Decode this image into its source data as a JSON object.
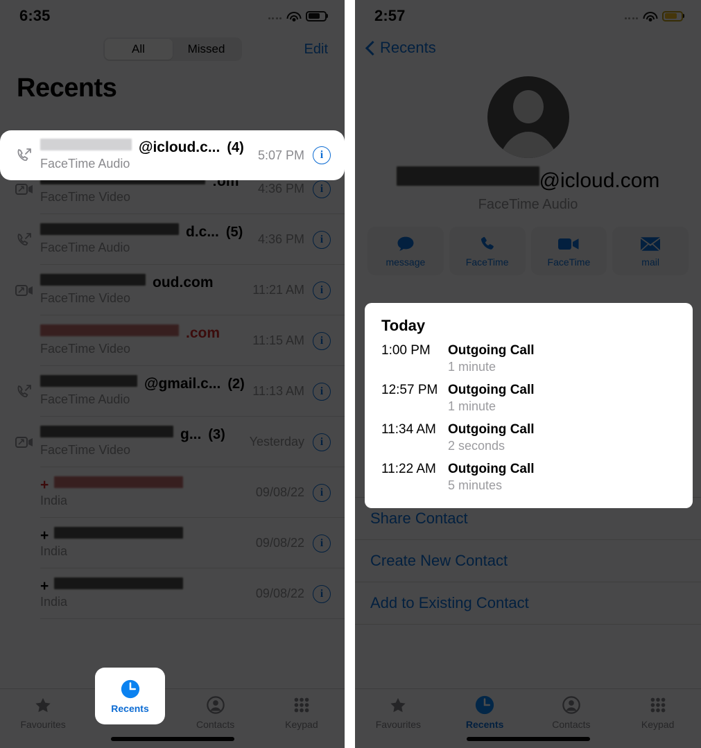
{
  "colors": {
    "accent_blue": "#0b6bd3",
    "missed_red": "#c62828",
    "muted_gray": "#8a8a8e",
    "dim_overlay": "#4d4d4d",
    "battery_low_power": "#e8b425"
  },
  "left_phone": {
    "status_bar": {
      "time": "6:35",
      "wifi": "wifi-icon",
      "battery": "battery-icon",
      "signal": "signal-dots-icon"
    },
    "segmented_control": {
      "options": [
        "All",
        "Missed"
      ],
      "selected": "All"
    },
    "edit_button": "Edit",
    "page_title": "Recents",
    "calls": [
      {
        "icon": "outgoing-audio-call-icon",
        "name_visible": "@icloud.c...",
        "redacted": true,
        "count": "(4)",
        "type": "FaceTime Audio",
        "time": "5:07 PM",
        "missed": false,
        "highlighted": true
      },
      {
        "icon": "outgoing-video-call-icon",
        "name_visible": ":om",
        "redacted": true,
        "count": "",
        "type": "FaceTime Video",
        "time": "4:36 PM",
        "missed": false,
        "highlighted": false
      },
      {
        "icon": "outgoing-audio-call-icon",
        "name_visible": "d.c...",
        "redacted": true,
        "count": "(5)",
        "type": "FaceTime Audio",
        "time": "4:36 PM",
        "missed": false,
        "highlighted": false
      },
      {
        "icon": "outgoing-video-call-icon",
        "name_visible": "oud.com",
        "redacted": true,
        "count": "",
        "type": "FaceTime Video",
        "time": "11:21 AM",
        "missed": false,
        "highlighted": false
      },
      {
        "icon": "",
        "name_visible": ".com",
        "redacted": true,
        "count": "",
        "type": "FaceTime Video",
        "time": "11:15 AM",
        "missed": true,
        "highlighted": false
      },
      {
        "icon": "outgoing-audio-call-icon",
        "name_visible": "@gmail.c...",
        "redacted": true,
        "count": "(2)",
        "type": "FaceTime Audio",
        "time": "11:13 AM",
        "missed": false,
        "highlighted": false
      },
      {
        "icon": "outgoing-video-call-icon",
        "name_visible": "g...",
        "redacted": true,
        "count": "(3)",
        "type": "FaceTime Video",
        "time": "Yesterday",
        "missed": false,
        "highlighted": false
      },
      {
        "icon": "",
        "name_visible": "+",
        "redacted": true,
        "count": "",
        "type": "India",
        "time": "09/08/22",
        "missed": true,
        "highlighted": false
      },
      {
        "icon": "",
        "name_visible": "+",
        "redacted": true,
        "count": "",
        "type": "India",
        "time": "09/08/22",
        "missed": false,
        "highlighted": false
      },
      {
        "icon": "",
        "name_visible": "+",
        "redacted": true,
        "count": "",
        "type": "India",
        "time": "09/08/22",
        "missed": false,
        "highlighted": false
      }
    ],
    "tabs": [
      {
        "label": "Favourites",
        "icon": "star-icon",
        "active": false
      },
      {
        "label": "Recents",
        "icon": "clock-icon",
        "active": true
      },
      {
        "label": "Contacts",
        "icon": "person-circle-icon",
        "active": false
      },
      {
        "label": "Keypad",
        "icon": "keypad-grid-icon",
        "active": false
      }
    ],
    "highlight_tab": "Recents"
  },
  "right_phone": {
    "status_bar": {
      "time": "2:57",
      "wifi": "wifi-icon",
      "battery": "battery-low-power-icon",
      "signal": "signal-dots-icon"
    },
    "back_button": "Recents",
    "avatar": "default-person-avatar-icon",
    "contact_id_visible": "@icloud.com",
    "contact_subtitle": "FaceTime Audio",
    "actions": [
      {
        "label": "message",
        "icon": "message-bubble-icon"
      },
      {
        "label": "FaceTime",
        "icon": "phone-handset-icon"
      },
      {
        "label": "FaceTime",
        "icon": "video-camera-icon"
      },
      {
        "label": "mail",
        "icon": "envelope-icon"
      }
    ],
    "history": {
      "section_title": "Today",
      "entries": [
        {
          "time": "1:00 PM",
          "kind": "Outgoing Call",
          "duration": "1 minute"
        },
        {
          "time": "12:57 PM",
          "kind": "Outgoing Call",
          "duration": "1 minute"
        },
        {
          "time": "11:34 AM",
          "kind": "Outgoing Call",
          "duration": "2 seconds"
        },
        {
          "time": "11:22 AM",
          "kind": "Outgoing Call",
          "duration": "5 minutes"
        }
      ]
    },
    "links": [
      "Share Contact",
      "Create New Contact",
      "Add to Existing Contact"
    ],
    "tabs": [
      {
        "label": "Favourites",
        "icon": "star-icon",
        "active": false
      },
      {
        "label": "Recents",
        "icon": "clock-icon",
        "active": true
      },
      {
        "label": "Contacts",
        "icon": "person-circle-icon",
        "active": false
      },
      {
        "label": "Keypad",
        "icon": "keypad-grid-icon",
        "active": false
      }
    ]
  }
}
